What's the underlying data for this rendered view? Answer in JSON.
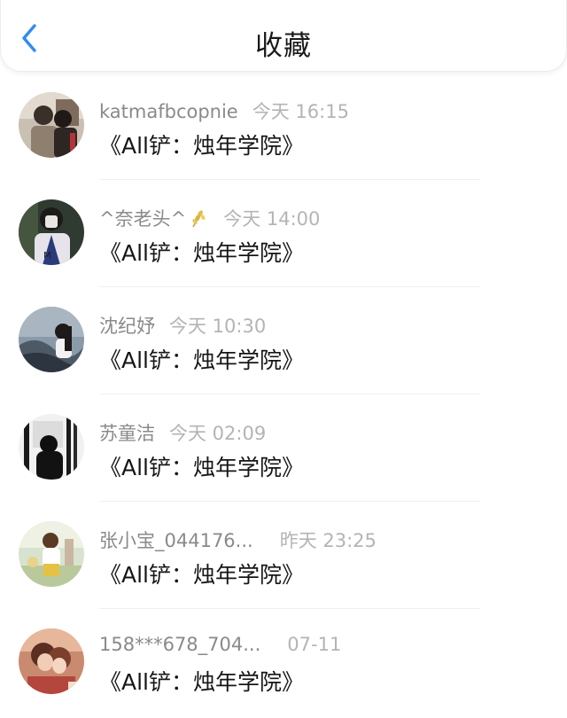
{
  "header": {
    "title": "收藏",
    "back_icon": "chevron-left-icon",
    "accent_color": "#2f8cf0"
  },
  "favorites": [
    {
      "user": "katmafbcopnie",
      "time": "今天 16:15",
      "title": "《All铲：烛年学院》"
    },
    {
      "user": "^奈老头^",
      "time": "今天 14:00",
      "title": "《All铲：烛年学院》",
      "emoji": "wheat-icon"
    },
    {
      "user": "沈纪妤",
      "time": "今天 10:30",
      "title": "《All铲：烛年学院》"
    },
    {
      "user": "苏童洁",
      "time": "今天 02:09",
      "title": "《All铲：烛年学院》"
    },
    {
      "user": "张小宝_044176...",
      "time": "昨天 23:25",
      "title": "《All铲：烛年学院》"
    },
    {
      "user": "158***678_704...",
      "time": "07-11",
      "title": "《All铲：烛年学院》"
    }
  ]
}
